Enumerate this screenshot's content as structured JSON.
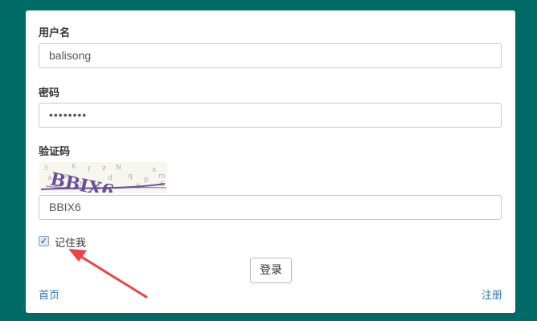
{
  "form": {
    "username_label": "用户名",
    "username_value": "balisong",
    "password_label": "密码",
    "password_value": "••••••••",
    "captcha_label": "验证码",
    "captcha_image_text": "BBIX6",
    "captcha_value": "BBIX6",
    "remember_label": "记住我",
    "remember_checked": true,
    "login_label": "登录",
    "home_link": "首页",
    "register_link": "注册"
  },
  "colors": {
    "background": "#006b66",
    "panel": "#ffffff",
    "link": "#2f77b1",
    "annotation_arrow": "#e84545",
    "captcha_text": "#6a4f9a"
  },
  "icons": {
    "checkbox": "checkmark-icon",
    "annotation": "red-arrow-icon"
  }
}
